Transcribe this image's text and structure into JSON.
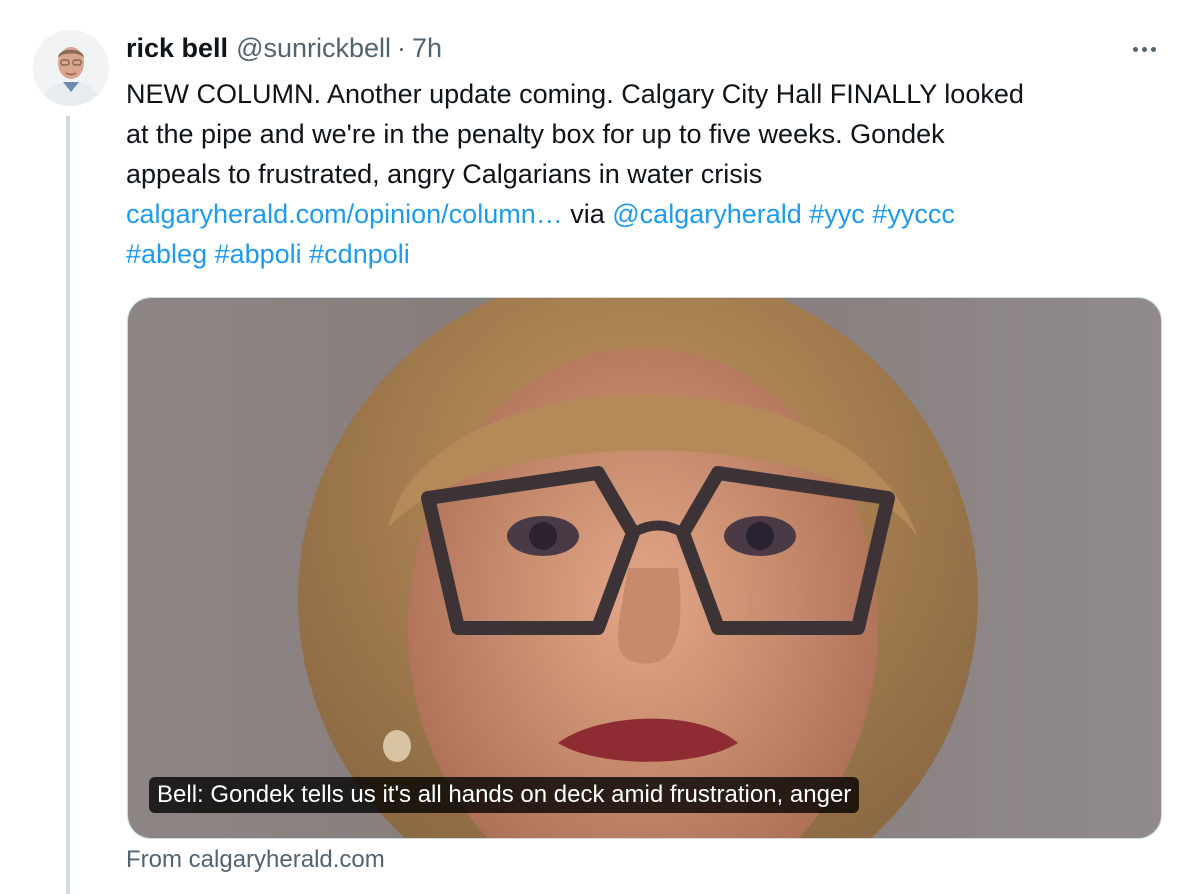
{
  "tweet": {
    "author_name": "rick bell",
    "handle": "@sunrickbell",
    "separator": "·",
    "time": "7h",
    "text_line1": "NEW COLUMN. Another update coming. Calgary City Hall FINALLY looked",
    "text_line2": "at the pipe and we're in the penalty box for up to five weeks. Gondek",
    "text_line3": "appeals to frustrated, angry Calgarians in water crisis",
    "link_url": "calgaryherald.com/opinion/column…",
    "via_text": " via ",
    "mention": "@calgaryherald",
    "hashtags_line4": " #yyc #yyccc",
    "hashtags_line5": "#ableg #abpoli #cdnpoli"
  },
  "card": {
    "caption": "Bell: Gondek tells us it's all hands on deck amid frustration, anger",
    "source": "From calgaryherald.com"
  },
  "colors": {
    "link": "#1d9bf0",
    "secondary_text": "#536471",
    "primary_text": "#0f1419",
    "thread_line": "#cfd9de"
  },
  "icons": {
    "more": "more-horizontal-icon"
  }
}
